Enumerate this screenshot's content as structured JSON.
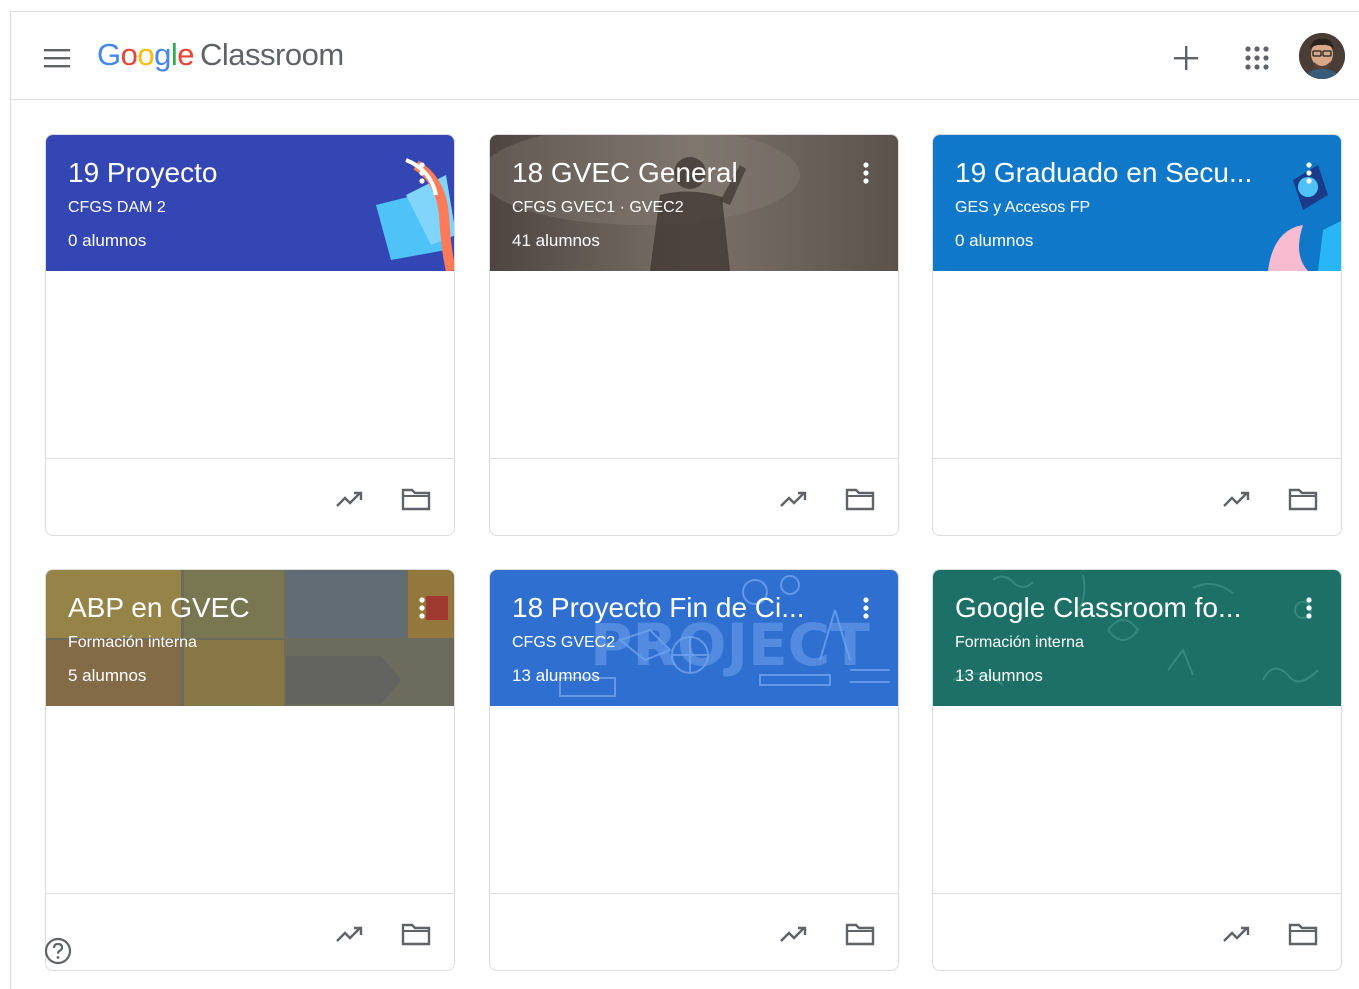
{
  "app": {
    "logo_letters": [
      "G",
      "o",
      "o",
      "g",
      "l",
      "e"
    ],
    "product_name": "Classroom",
    "menu_icon": "hamburger-menu-icon",
    "create_icon": "plus-icon",
    "apps_icon": "apps-grid-icon",
    "avatar_icon": "user-avatar"
  },
  "colors": {
    "google_blue": "#4285f4",
    "google_red": "#ea4335",
    "google_yellow": "#fbbc05",
    "google_green": "#34a853",
    "icon_gray": "#5f6368",
    "border": "#dadce0"
  },
  "classes": [
    {
      "title": "19 Proyecto",
      "section": "CFGS DAM 2",
      "students": "0 alumnos",
      "theme": "#3346b4"
    },
    {
      "title": "18 GVEC General",
      "section": "CFGS GVEC1 · GVEC2",
      "students": "41 alumnos",
      "theme": "#6b625c"
    },
    {
      "title": "19 Graduado en Secu...",
      "section": "GES y Accesos FP",
      "students": "0 alumnos",
      "theme": "#0f78c8"
    },
    {
      "title": "ABP en GVEC",
      "section": "Formación interna",
      "students": "5 alumnos",
      "theme": "#7a7a68"
    },
    {
      "title": "18 Proyecto Fin de Ci...",
      "section": "CFGS GVEC2",
      "students": "13 alumnos",
      "theme": "#2f6fcf"
    },
    {
      "title": "Google Classroom fo...",
      "section": "Formación interna",
      "students": "13 alumnos",
      "theme": "#1c7066"
    }
  ],
  "card_icons": {
    "more": "more-vert-icon",
    "progress": "trending-up-icon",
    "folder": "folder-icon"
  },
  "help_icon": "help-circle-icon"
}
